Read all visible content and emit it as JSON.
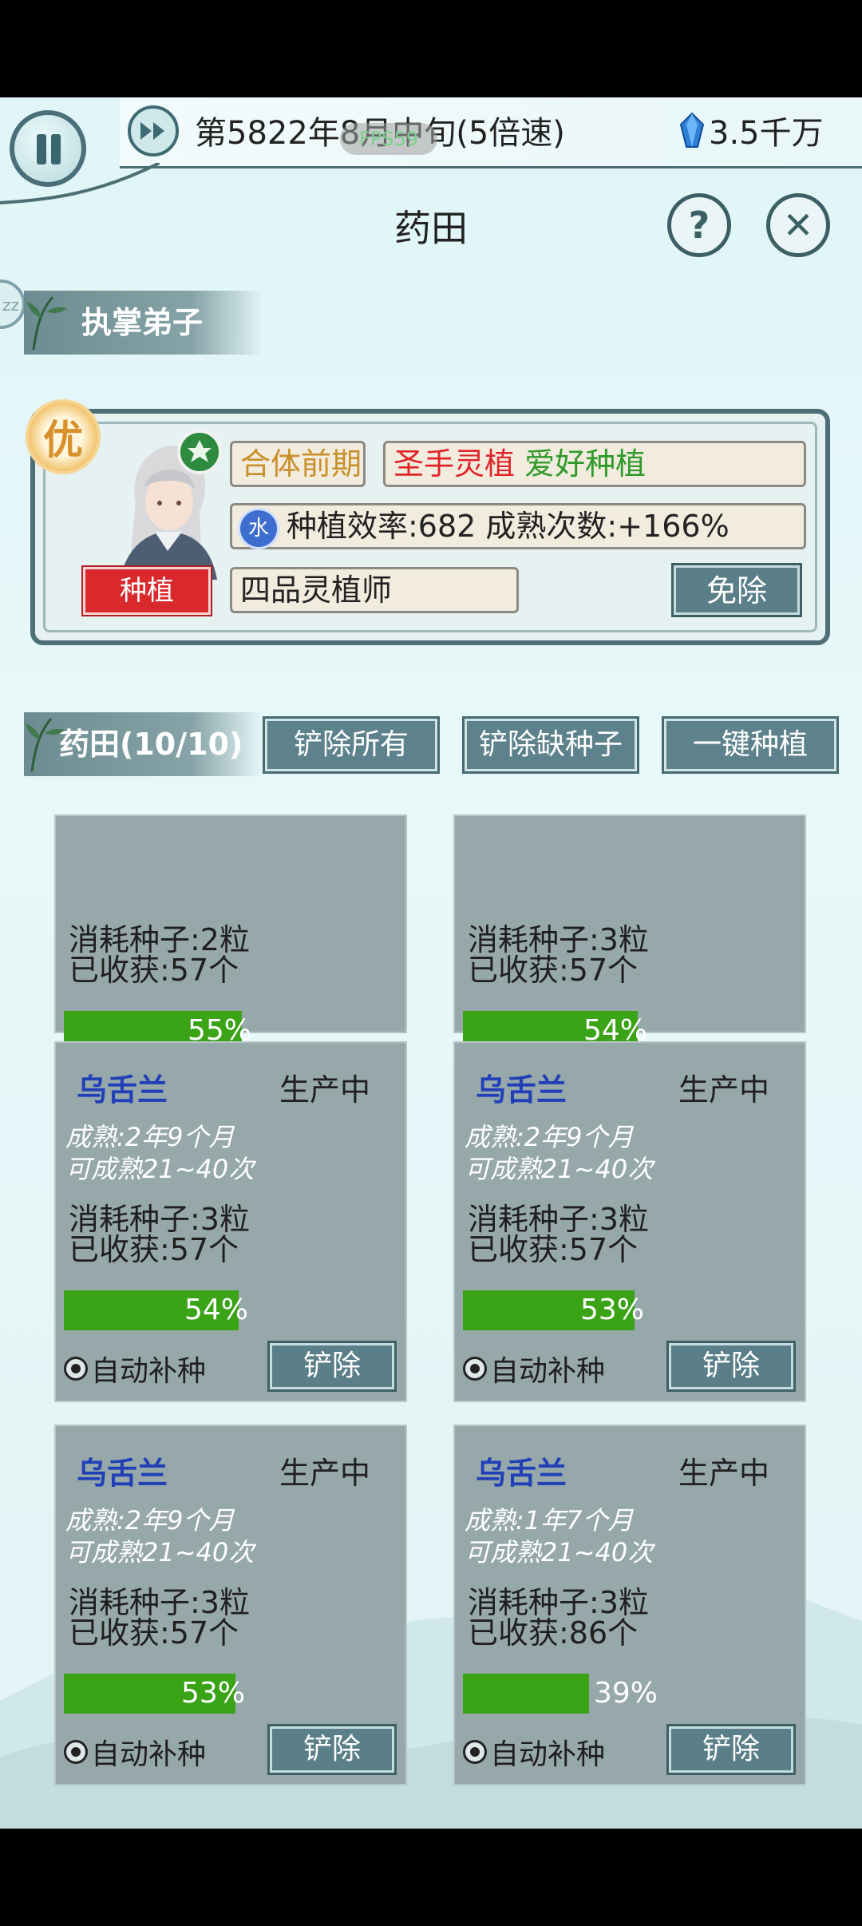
{
  "header": {
    "date": "第5822年8月中旬(5倍速)",
    "fps": "FPS59",
    "money": "3.5千万"
  },
  "page_title": "药田",
  "side_bubble": "zz",
  "disciple_section": {
    "title": "执掌弟子",
    "badge": "优",
    "role": "种植",
    "realm": "合体前期",
    "trait_1": "圣手灵植",
    "trait_2": "爱好种植",
    "element": "水",
    "stats": "种植效率:682 成熟次数:+166%",
    "rank": "四品灵植师",
    "dismiss_label": "免除"
  },
  "field_section": {
    "title": "药田(10/10)",
    "remove_all": "铲除所有",
    "remove_no_seed": "铲除缺种子",
    "plant_all": "一键种植"
  },
  "common": {
    "auto_replant": "自动补种",
    "remove": "铲除"
  },
  "plots": [
    {
      "seeds": "消耗种子:2粒",
      "harvested": "已收获:57个",
      "progress": 55,
      "progress_label": "55%"
    },
    {
      "seeds": "消耗种子:3粒",
      "harvested": "已收获:57个",
      "progress": 54,
      "progress_label": "54%"
    },
    {
      "herb": "乌舌兰",
      "status": "生产中",
      "mature": "成熟:2年9个月",
      "times": "可成熟21~40次",
      "seeds": "消耗种子:3粒",
      "harvested": "已收获:57个",
      "progress": 54,
      "progress_label": "54%"
    },
    {
      "herb": "乌舌兰",
      "status": "生产中",
      "mature": "成熟:2年9个月",
      "times": "可成熟21~40次",
      "seeds": "消耗种子:3粒",
      "harvested": "已收获:57个",
      "progress": 53,
      "progress_label": "53%"
    },
    {
      "herb": "乌舌兰",
      "status": "生产中",
      "mature": "成熟:2年9个月",
      "times": "可成熟21~40次",
      "seeds": "消耗种子:3粒",
      "harvested": "已收获:57个",
      "progress": 53,
      "progress_label": "53%"
    },
    {
      "herb": "乌舌兰",
      "status": "生产中",
      "mature": "成熟:1年7个月",
      "times": "可成熟21~40次",
      "seeds": "消耗种子:3粒",
      "harvested": "已收获:86个",
      "progress": 39,
      "progress_label": "39%"
    }
  ],
  "colors": {
    "herb_name": "#2140b8",
    "progress_fill": "#3aa316",
    "trait_1": "#e0262a",
    "trait_2": "#2f9a2a",
    "realm": "#c9902a"
  }
}
